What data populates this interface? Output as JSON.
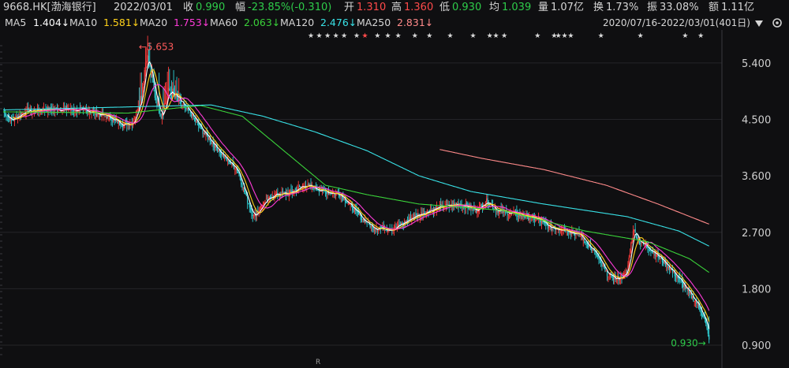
{
  "header": {
    "title": "9668.HK[渤海银行]",
    "date": "2022/03/01",
    "close_label": "收",
    "close_value": "0.990",
    "change_label": "幅",
    "change_value": "-23.85%(-0.310)",
    "open_label": "开",
    "open_value": "1.310",
    "high_label": "高",
    "high_value": "1.360",
    "low_label": "低",
    "low_value": "0.930",
    "avg_label": "均",
    "avg_value": "1.039",
    "volume_label": "量",
    "volume_value": "1.07亿",
    "turnover_label": "换",
    "turnover_value": "1.73%",
    "amplitude_label": "振",
    "amplitude_value": "33.08%",
    "amount_label": "额",
    "amount_value": "1.11亿"
  },
  "ma_bar": {
    "items": [
      {
        "name": "MA5",
        "value": "1.404↓",
        "color": "#ffffff"
      },
      {
        "name": "MA10",
        "value": "1.581↓",
        "color": "#ffd21a"
      },
      {
        "name": "MA20",
        "value": "1.753↓",
        "color": "#ff3bd9"
      },
      {
        "name": "MA60",
        "value": "2.063↓",
        "color": "#3ad13a"
      },
      {
        "name": "MA120",
        "value": "2.476↓",
        "color": "#38e1e6"
      },
      {
        "name": "MA250",
        "value": "2.831↓",
        "color": "#ff8a8a"
      }
    ],
    "range_label": "2020/07/16-2022/03/01(401日)",
    "dropdown_icon": "triangle-down-icon"
  },
  "chart_data": {
    "type": "line",
    "ylim": [
      0.75,
      5.85
    ],
    "yticks": [
      "5.400",
      "4.500",
      "3.600",
      "2.700",
      "1.800",
      "0.900"
    ],
    "ytick_values": [
      5.4,
      4.5,
      3.6,
      2.7,
      1.8,
      0.9
    ],
    "high_annotation": "←5.653",
    "low_annotation": "0.930→",
    "high_value": 5.653,
    "low_value": 0.93,
    "x_marker": "R",
    "grid": true,
    "colors": {
      "up": "#ff3b3b",
      "down": "#2fd0d6",
      "ma5": "#ffffff",
      "ma10": "#ffd21a",
      "ma20": "#ff3bd9",
      "ma60": "#3ad13a",
      "ma120": "#38e1e6",
      "ma250": "#ff8a8a"
    },
    "n_bars": 401,
    "close_anchors": [
      [
        0,
        4.62
      ],
      [
        8,
        4.48
      ],
      [
        20,
        4.62
      ],
      [
        40,
        4.66
      ],
      [
        60,
        4.66
      ],
      [
        80,
        4.64
      ],
      [
        100,
        4.55
      ],
      [
        115,
        4.42
      ],
      [
        125,
        4.45
      ],
      [
        133,
        4.9
      ],
      [
        138,
        5.55
      ],
      [
        145,
        4.95
      ],
      [
        152,
        4.6
      ],
      [
        160,
        4.95
      ],
      [
        170,
        4.75
      ],
      [
        180,
        4.6
      ],
      [
        190,
        4.35
      ],
      [
        205,
        4.05
      ],
      [
        215,
        3.85
      ],
      [
        225,
        3.7
      ],
      [
        235,
        3.2
      ],
      [
        241,
        2.95
      ],
      [
        250,
        3.15
      ],
      [
        260,
        3.3
      ],
      [
        275,
        3.32
      ],
      [
        290,
        3.45
      ],
      [
        300,
        3.4
      ],
      [
        310,
        3.35
      ],
      [
        325,
        3.3
      ],
      [
        335,
        3.1
      ],
      [
        345,
        2.92
      ],
      [
        355,
        2.78
      ],
      [
        375,
        2.75
      ],
      [
        395,
        2.95
      ],
      [
        410,
        3.05
      ],
      [
        420,
        3.1
      ],
      [
        440,
        3.15
      ],
      [
        455,
        3.05
      ],
      [
        465,
        3.2
      ],
      [
        475,
        3.05
      ],
      [
        490,
        3.0
      ],
      [
        505,
        2.95
      ],
      [
        515,
        2.9
      ],
      [
        525,
        2.78
      ],
      [
        540,
        2.75
      ],
      [
        555,
        2.65
      ],
      [
        570,
        2.35
      ],
      [
        580,
        2.05
      ],
      [
        590,
        1.95
      ],
      [
        600,
        2.05
      ],
      [
        606,
        2.75
      ],
      [
        612,
        2.55
      ],
      [
        625,
        2.4
      ],
      [
        640,
        2.15
      ],
      [
        650,
        1.95
      ],
      [
        660,
        1.72
      ],
      [
        668,
        1.55
      ],
      [
        675,
        1.3
      ],
      [
        679,
        0.99
      ]
    ],
    "ma_series": {
      "ma60": [
        [
          0,
          4.62
        ],
        [
          120,
          4.6
        ],
        [
          190,
          4.72
        ],
        [
          230,
          4.55
        ],
        [
          270,
          4.0
        ],
        [
          310,
          3.45
        ],
        [
          350,
          3.3
        ],
        [
          400,
          3.15
        ],
        [
          480,
          3.05
        ],
        [
          560,
          2.72
        ],
        [
          620,
          2.55
        ],
        [
          660,
          2.28
        ],
        [
          679,
          2.06
        ]
      ],
      "ma120": [
        [
          0,
          4.65
        ],
        [
          200,
          4.73
        ],
        [
          250,
          4.55
        ],
        [
          300,
          4.3
        ],
        [
          350,
          4.0
        ],
        [
          400,
          3.6
        ],
        [
          450,
          3.35
        ],
        [
          520,
          3.15
        ],
        [
          600,
          2.95
        ],
        [
          650,
          2.72
        ],
        [
          679,
          2.48
        ]
      ],
      "ma250": [
        [
          420,
          4.02
        ],
        [
          460,
          3.88
        ],
        [
          520,
          3.7
        ],
        [
          580,
          3.45
        ],
        [
          630,
          3.15
        ],
        [
          679,
          2.83
        ]
      ]
    },
    "star_markers": [
      [
        296,
        "#d8d8d8"
      ],
      [
        304,
        "#d8d8d8"
      ],
      [
        312,
        "#d8d8d8"
      ],
      [
        320,
        "#d8d8d8"
      ],
      [
        328,
        "#d8d8d8"
      ],
      [
        340,
        "#d8d8d8"
      ],
      [
        348,
        "#ff4a4a"
      ],
      [
        360,
        "#d8d8d8"
      ],
      [
        370,
        "#d8d8d8"
      ],
      [
        380,
        "#d8d8d8"
      ],
      [
        396,
        "#d8d8d8"
      ],
      [
        410,
        "#d8d8d8"
      ],
      [
        430,
        "#d8d8d8"
      ],
      [
        452,
        "#d8d8d8"
      ],
      [
        468,
        "#d8d8d8"
      ],
      [
        474,
        "#d8d8d8"
      ],
      [
        482,
        "#d8d8d8"
      ],
      [
        514,
        "#d8d8d8"
      ],
      [
        530,
        "#d8d8d8"
      ],
      [
        534,
        "#d8d8d8"
      ],
      [
        540,
        "#d8d8d8"
      ],
      [
        546,
        "#d8d8d8"
      ],
      [
        575,
        "#d8d8d8"
      ],
      [
        613,
        "#d8d8d8"
      ],
      [
        656,
        "#d8d8d8"
      ],
      [
        671,
        "#d8d8d8"
      ]
    ]
  }
}
